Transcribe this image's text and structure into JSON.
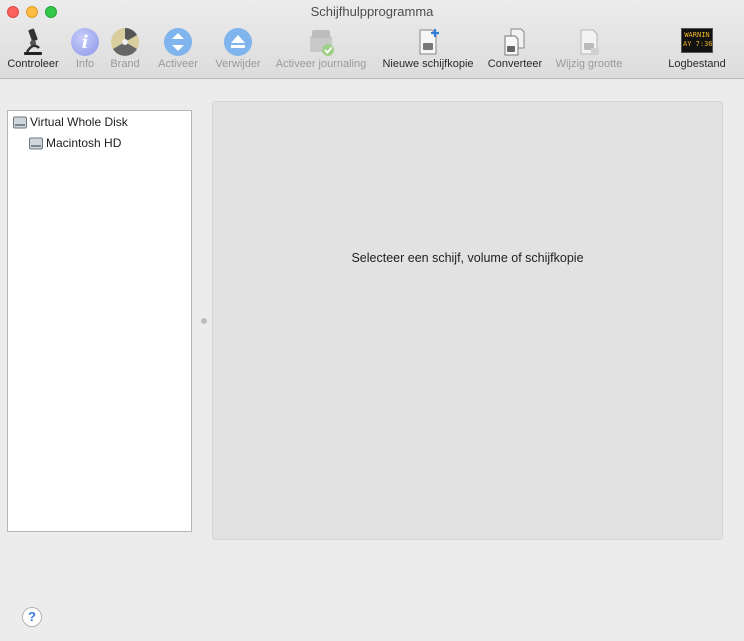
{
  "window": {
    "title": "Schijfhulpprogramma"
  },
  "toolbar": {
    "controleer": "Controleer",
    "info": "Info",
    "brand": "Brand",
    "activeer": "Activeer",
    "verwijder": "Verwijder",
    "activeer_journaling": "Activeer journaling",
    "nieuwe_schijfkopie": "Nieuwe schijfkopie",
    "converteer": "Converteer",
    "wijzig_grootte": "Wijzig grootte",
    "logbestand": "Logbestand",
    "log_icon_text": [
      "WARNIN",
      "AY 7:36"
    ]
  },
  "sidebar": {
    "items": [
      {
        "label": "Virtual Whole Disk"
      },
      {
        "label": "Macintosh HD"
      }
    ]
  },
  "main": {
    "message": "Selecteer een schijf, volume of schijfkopie"
  },
  "help": {
    "label": "?"
  },
  "colors": {
    "accent": "#3a7be0",
    "close": "#fc615d",
    "minimize": "#fdbc40",
    "maximize": "#34c84a"
  }
}
